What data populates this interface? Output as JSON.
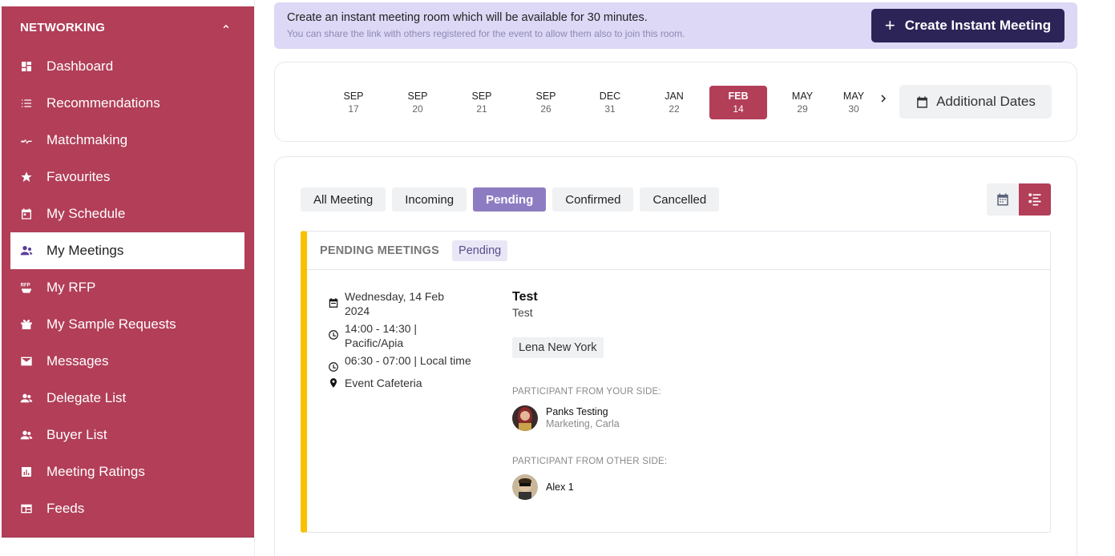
{
  "sidebar": {
    "heading": "NETWORKING",
    "items": [
      {
        "label": "Dashboard",
        "icon": "dashboard-icon"
      },
      {
        "label": "Recommendations",
        "icon": "list-icon"
      },
      {
        "label": "Matchmaking",
        "icon": "matchmaking-icon"
      },
      {
        "label": "Favourites",
        "icon": "star-icon"
      },
      {
        "label": "My Schedule",
        "icon": "calendar-icon"
      },
      {
        "label": "My Meetings",
        "icon": "meetings-icon",
        "active": true
      },
      {
        "label": "My RFP",
        "icon": "rfp-icon"
      },
      {
        "label": "My Sample Requests",
        "icon": "sample-icon"
      },
      {
        "label": "Messages",
        "icon": "mail-icon"
      },
      {
        "label": "Delegate List",
        "icon": "people-icon"
      },
      {
        "label": "Buyer List",
        "icon": "people-icon"
      },
      {
        "label": "Meeting Ratings",
        "icon": "chart-icon"
      },
      {
        "label": "Feeds",
        "icon": "feeds-icon"
      }
    ]
  },
  "banner": {
    "line1": "Create an instant meeting room which will be available for 30 minutes.",
    "line2": "You can share the link with others registered for the event to allow them also to join this room.",
    "button_label": "Create Instant Meeting"
  },
  "dates": {
    "items": [
      {
        "month": "SEP",
        "day": "17"
      },
      {
        "month": "SEP",
        "day": "20"
      },
      {
        "month": "SEP",
        "day": "21"
      },
      {
        "month": "SEP",
        "day": "26"
      },
      {
        "month": "DEC",
        "day": "31"
      },
      {
        "month": "JAN",
        "day": "22"
      },
      {
        "month": "FEB",
        "day": "14",
        "selected": true
      },
      {
        "month": "MAY",
        "day": "29"
      },
      {
        "month": "MAY",
        "day": "30"
      }
    ],
    "next_glyph": "›",
    "additional_label": "Additional Dates"
  },
  "tabs": [
    {
      "label": "All Meeting"
    },
    {
      "label": "Incoming"
    },
    {
      "label": "Pending",
      "active": true
    },
    {
      "label": "Confirmed"
    },
    {
      "label": "Cancelled"
    }
  ],
  "meeting_panel": {
    "title": "PENDING MEETINGS",
    "badge": "Pending",
    "date": "Wednesday, 14 Feb 2024",
    "time_event": "14:00 - 14:30 | Pacific/Apia",
    "time_local": "06:30 - 07:00 | Local time",
    "location": "Event Cafeteria",
    "meeting_title": "Test",
    "meeting_subtitle": "Test",
    "tag": "Lena New York",
    "your_side_label": "PARTICIPANT FROM YOUR SIDE:",
    "your_side": {
      "name": "Panks Testing",
      "role": "Marketing, Carla"
    },
    "other_side_label": "PARTICIPANT FROM OTHER SIDE:",
    "other_side": {
      "name": "Alex 1"
    }
  },
  "colors": {
    "sidebar_bg": "#b23e58",
    "banner_bg": "#dcd8f6",
    "primary_dark": "#2c2457",
    "selected_date": "#b23e58",
    "active_tab": "#8e7cc3",
    "pending_border": "#f7c100"
  }
}
